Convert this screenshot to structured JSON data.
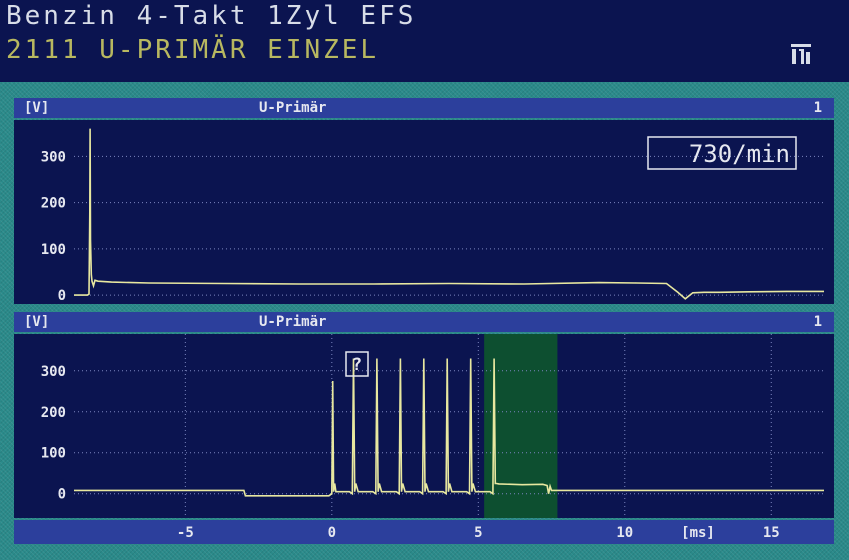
{
  "header": {
    "line1": "Benzin 4-Takt 1Zyl EFS",
    "line2": "2111 U-PRIMÄR EINZEL",
    "icon": "print-icon"
  },
  "chart_data": [
    {
      "type": "line",
      "title": "U-Primär",
      "ylabel": "[V]",
      "channel": "1",
      "readout": "730/min",
      "ylim": [
        -15,
        370
      ],
      "yticks": [
        0,
        100,
        200,
        300
      ],
      "grid": true,
      "series": [
        {
          "x": [
            0,
            0.18,
            0.2,
            0.21,
            0.215,
            0.22,
            0.23,
            0.24,
            0.26,
            0.28,
            0.32,
            0.5,
            1.0,
            2.0,
            3.0,
            4.0,
            5.0,
            6.0,
            7.0,
            7.5,
            7.9,
            8.05,
            8.15,
            8.25,
            8.4,
            8.6,
            9.0,
            9.5,
            10.0
          ],
          "y": [
            0,
            0,
            2,
            180,
            360,
            120,
            45,
            30,
            20,
            32,
            30,
            28,
            26,
            25,
            24,
            24,
            25,
            24,
            27,
            26,
            25,
            6,
            -8,
            5,
            6,
            6,
            7,
            8,
            8
          ]
        }
      ]
    },
    {
      "type": "line",
      "title": "U-Primär",
      "ylabel": "[V]",
      "channel": "1",
      "marker": "?",
      "xlabel": "[ms]",
      "xlim": [
        -8.8,
        16.8
      ],
      "xticks": [
        -5,
        0,
        5,
        10,
        15
      ],
      "ylim": [
        -30,
        380
      ],
      "yticks": [
        0,
        100,
        200,
        300
      ],
      "grid": true,
      "highlight": [
        5.2,
        7.7
      ],
      "series": [
        {
          "x": [
            -8.8,
            -3.0,
            -2.95,
            -0.1,
            0.0,
            0.03,
            0.06,
            0.1,
            0.14,
            0.6,
            0.7,
            0.74,
            0.78,
            0.82,
            0.9,
            1.4,
            1.5,
            1.54,
            1.58,
            1.62,
            1.7,
            2.2,
            2.3,
            2.34,
            2.38,
            2.42,
            2.5,
            3.0,
            3.1,
            3.14,
            3.18,
            3.22,
            3.3,
            3.8,
            3.9,
            3.94,
            3.98,
            4.02,
            4.1,
            4.6,
            4.7,
            4.74,
            4.78,
            4.82,
            4.9,
            5.4,
            5.5,
            5.54,
            5.58,
            5.62,
            5.7,
            6.5,
            7.2,
            7.35,
            7.4,
            7.45,
            7.5,
            7.6,
            16.8
          ],
          "y": [
            8,
            8,
            -5,
            -5,
            0,
            275,
            5,
            25,
            5,
            5,
            0,
            330,
            5,
            25,
            5,
            5,
            0,
            330,
            5,
            25,
            5,
            5,
            0,
            330,
            5,
            25,
            5,
            5,
            0,
            330,
            5,
            25,
            5,
            5,
            0,
            330,
            5,
            25,
            5,
            5,
            0,
            330,
            5,
            25,
            5,
            5,
            0,
            330,
            25,
            25,
            24,
            22,
            23,
            20,
            0,
            18,
            8,
            8,
            8
          ]
        }
      ]
    }
  ]
}
